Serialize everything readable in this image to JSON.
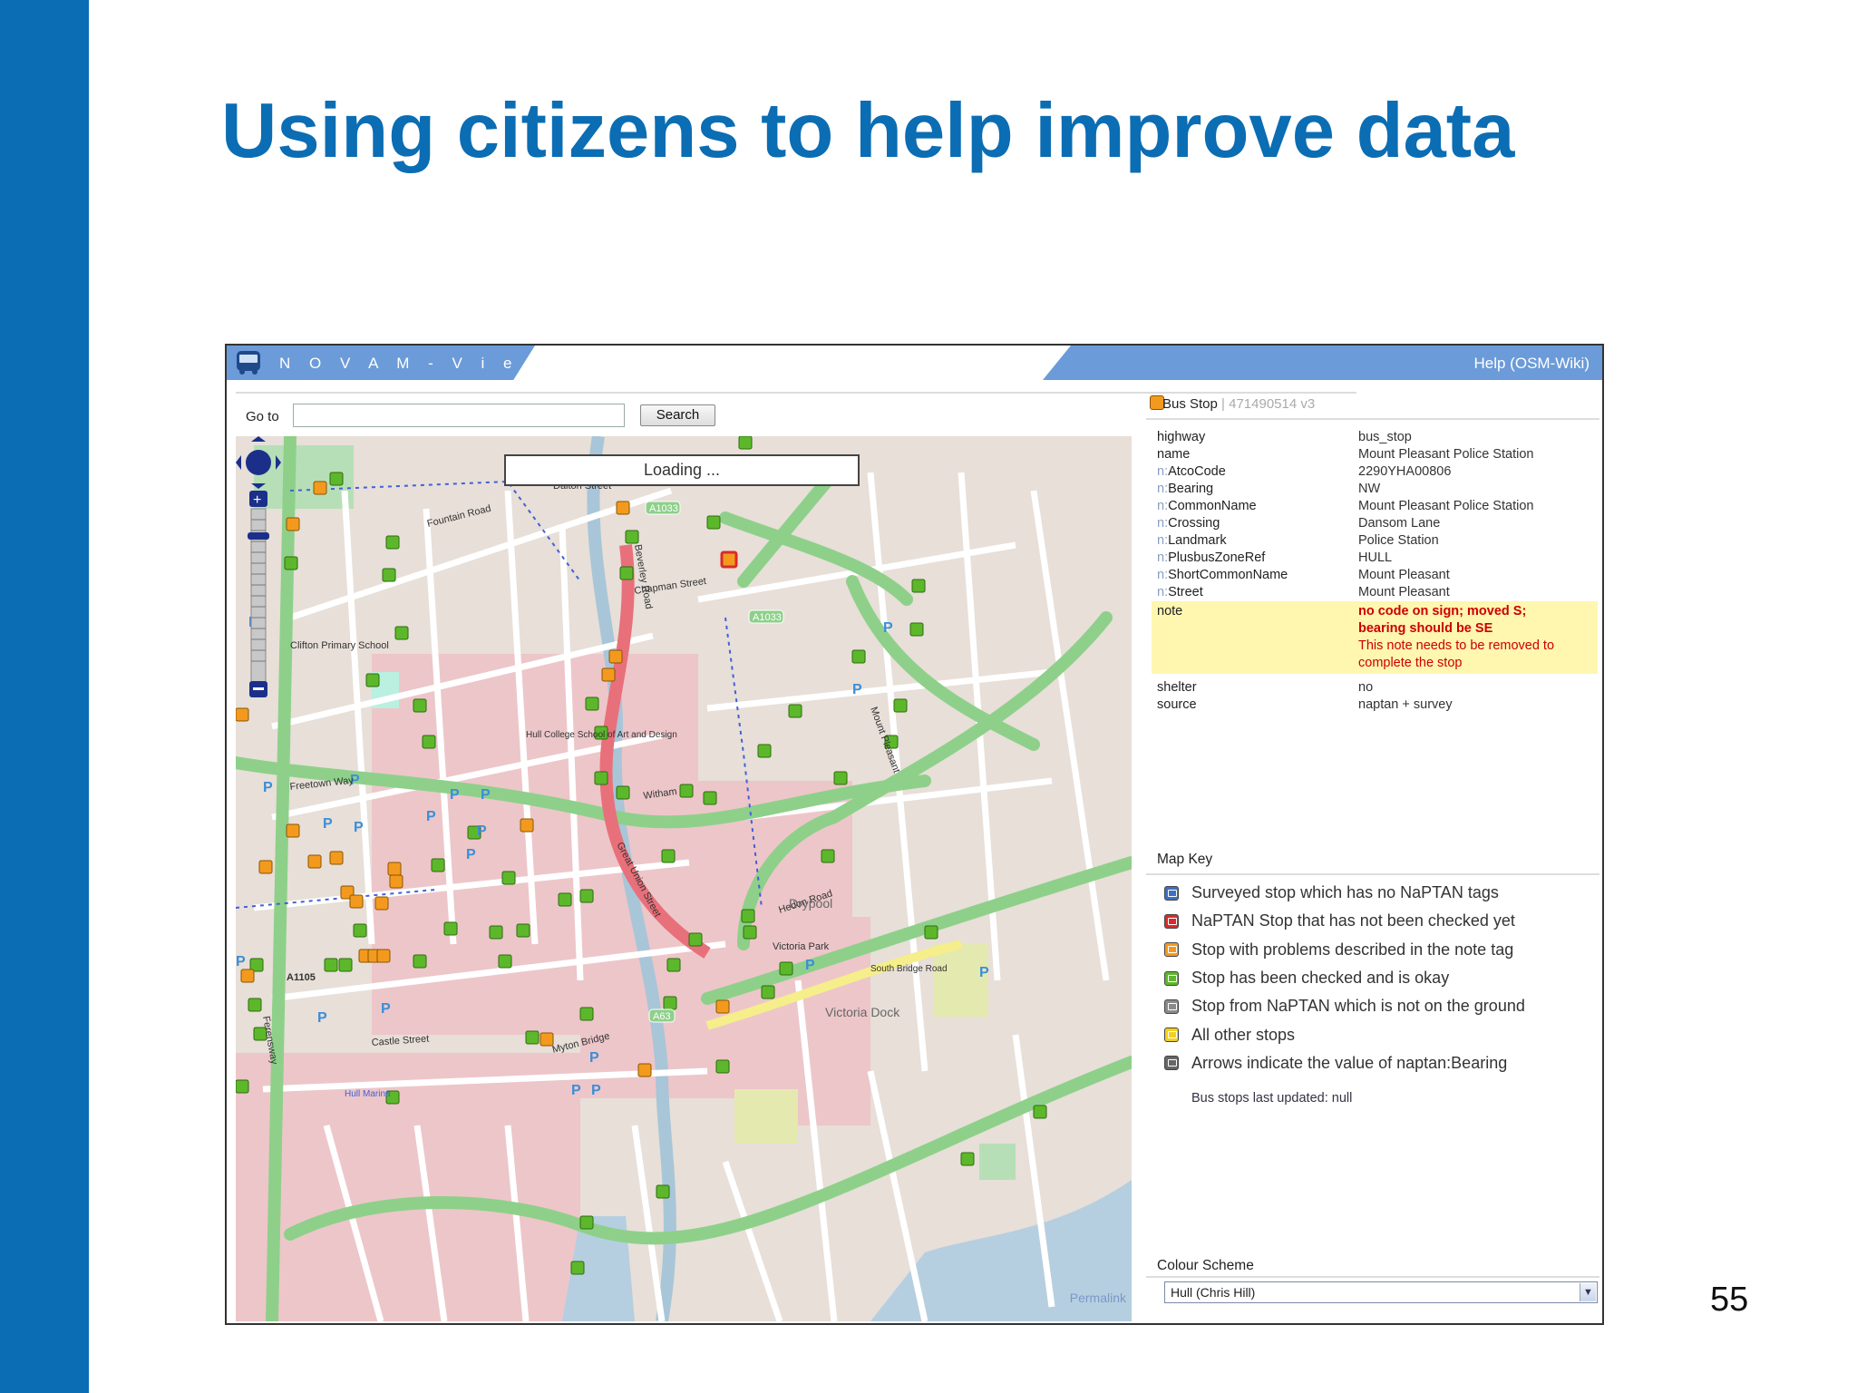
{
  "slide": {
    "title": "Using citizens to help improve data",
    "page_number": "55",
    "accent_color": "#0b6db3"
  },
  "app": {
    "name": "N O V A M - V i e w e r",
    "help_link": "Help (OSM-Wiki)",
    "header_color": "#6b9bd8"
  },
  "toolbar": {
    "goto_label": "Go to",
    "goto_value": "",
    "search_label": "Search"
  },
  "map": {
    "loading_text": "Loading ...",
    "permalink": "Permalink",
    "labels": {
      "dalton": "Dalton Street",
      "fountain": "Fountain Road",
      "chapman": "Chapman Street",
      "beverley": "Beverley Road",
      "ferensway": "Ferensway",
      "freetown": "Freetown Way",
      "witham": "Witham",
      "hedon": "Hedon Road",
      "castle": "Castle Street",
      "a1033": "A1033",
      "a1105": "A1105",
      "a63": "A63",
      "drypool": "Drypool",
      "victoria_park": "Victoria Park",
      "victoria_dock": "Victoria Dock",
      "mount_pleasant": "Mount Pleasant",
      "great_union": "Great Union Street",
      "clifton_school": "Clifton Primary School",
      "hull_college": "Hull College School of Art and Design",
      "myton_bridge": "Myton Bridge",
      "hull_marina": "Hull Marina",
      "south_bridge": "South Bridge Road"
    }
  },
  "bus_stop": {
    "heading": "Bus Stop",
    "version": "| 471490514 v3",
    "tags": [
      {
        "ns": "",
        "key": "highway",
        "value": "bus_stop"
      },
      {
        "ns": "",
        "key": "name",
        "value": "Mount Pleasant Police Station"
      },
      {
        "ns": "n:",
        "key": "AtcoCode",
        "value": "2290YHA00806"
      },
      {
        "ns": "n:",
        "key": "Bearing",
        "value": "NW"
      },
      {
        "ns": "n:",
        "key": "CommonName",
        "value": "Mount Pleasant Police Station"
      },
      {
        "ns": "n:",
        "key": "Crossing",
        "value": "Dansom Lane"
      },
      {
        "ns": "n:",
        "key": "Landmark",
        "value": "Police Station"
      },
      {
        "ns": "n:",
        "key": "PlusbusZoneRef",
        "value": "HULL"
      },
      {
        "ns": "n:",
        "key": "ShortCommonName",
        "value": "Mount Pleasant"
      },
      {
        "ns": "n:",
        "key": "Street",
        "value": "Mount Pleasant"
      }
    ],
    "note": {
      "key": "note",
      "warning_line1": "no code on sign; moved S;",
      "warning_line2": "bearing should be SE",
      "hint_line1": "This note needs to be removed to",
      "hint_line2": "complete the stop"
    },
    "tags_after": [
      {
        "ns": "",
        "key": "shelter",
        "value": "no"
      },
      {
        "ns": "",
        "key": "source",
        "value": "naptan + survey"
      }
    ]
  },
  "map_key": {
    "title": "Map Key",
    "items": [
      {
        "label": "Surveyed stop which has no NaPTAN tags",
        "color": "#3d6fc4",
        "icon": "bus-stop-blue-icon"
      },
      {
        "label": "NaPTAN Stop that has not been checked yet",
        "color": "#d92b2b",
        "icon": "bus-stop-red-icon"
      },
      {
        "label": "Stop with problems described in the note tag",
        "color": "#f39a1e",
        "icon": "bus-stop-orange-icon"
      },
      {
        "label": "Stop has been checked and is okay",
        "color": "#5cb82a",
        "icon": "bus-stop-green-icon"
      },
      {
        "label": "Stop from NaPTAN which is not on the ground",
        "color": "#8a8a8a",
        "icon": "bus-stop-grey-icon"
      },
      {
        "label": "All other stops",
        "color": "#f2d11c",
        "icon": "bus-stop-yellow-icon"
      },
      {
        "label": "Arrows indicate the value of naptan:Bearing",
        "color": "#666666",
        "icon": "bearing-arrow-icon"
      }
    ],
    "updated": "Bus stops last updated: null"
  },
  "colour_scheme": {
    "title": "Colour Scheme",
    "selected": "Hull (Chris Hill)"
  }
}
